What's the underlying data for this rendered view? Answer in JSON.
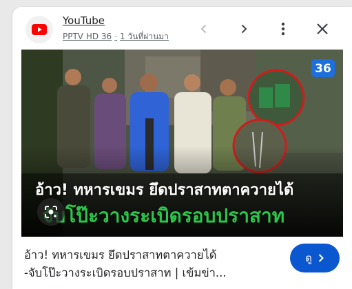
{
  "source": {
    "name": "YouTube",
    "channel": "PPTV HD 36",
    "separator": "·",
    "time": "1 วันที่ผ่านมา"
  },
  "header_buttons": {
    "prev": "chevron-left-icon",
    "next": "chevron-right-icon",
    "more": "more-vert-icon",
    "close": "close-icon"
  },
  "thumbnail": {
    "logo_text": "36",
    "headline_line1": "อ้าว! ทหารเขมร ยึดปราสาทตาควายได้",
    "headline_line2": "จับโป๊ะวางระเบิดรอบปราสาท",
    "colors": {
      "headline1": "#ffffff",
      "headline2": "#2cc64a",
      "circle": "#d31b1b"
    }
  },
  "result": {
    "title_line1": "อ้าว! ทหารเขมร ยึดปราสาทตาควายได้",
    "title_line2": "-จับโป๊ะวางระเบิดรอบปราสาท | เข้มข่า...",
    "view_button": "ดู"
  },
  "colors": {
    "accent": "#0b57d0",
    "youtube_red": "#ff0000"
  }
}
